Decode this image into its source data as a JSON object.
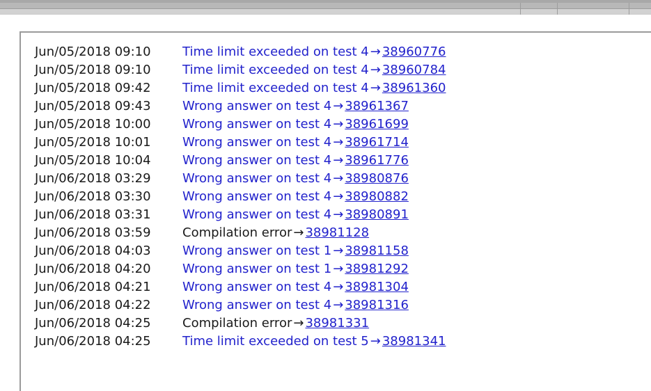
{
  "top_chrome": {
    "divider_positions": [
      747,
      800,
      903
    ]
  },
  "submissions": {
    "rows": [
      {
        "date": "Jun/05/2018 09:10",
        "verdict": "Time limit exceeded on test 4",
        "verdict_style": "blue",
        "arrow": "→",
        "id": "38960776"
      },
      {
        "date": "Jun/05/2018 09:10",
        "verdict": "Time limit exceeded on test 4",
        "verdict_style": "blue",
        "arrow": "→",
        "id": "38960784"
      },
      {
        "date": "Jun/05/2018 09:42",
        "verdict": "Time limit exceeded on test 4",
        "verdict_style": "blue",
        "arrow": "→",
        "id": "38961360"
      },
      {
        "date": "Jun/05/2018 09:43",
        "verdict": "Wrong answer on test 4",
        "verdict_style": "blue",
        "arrow": "→",
        "id": "38961367"
      },
      {
        "date": "Jun/05/2018 10:00",
        "verdict": "Wrong answer on test 4",
        "verdict_style": "blue",
        "arrow": "→",
        "id": "38961699"
      },
      {
        "date": "Jun/05/2018 10:01",
        "verdict": "Wrong answer on test 4",
        "verdict_style": "blue",
        "arrow": "→",
        "id": "38961714"
      },
      {
        "date": "Jun/05/2018 10:04",
        "verdict": "Wrong answer on test 4",
        "verdict_style": "blue",
        "arrow": "→",
        "id": "38961776"
      },
      {
        "date": "Jun/06/2018 03:29",
        "verdict": "Wrong answer on test 4",
        "verdict_style": "blue",
        "arrow": "→",
        "id": "38980876"
      },
      {
        "date": "Jun/06/2018 03:30",
        "verdict": "Wrong answer on test 4",
        "verdict_style": "blue",
        "arrow": "→",
        "id": "38980882"
      },
      {
        "date": "Jun/06/2018 03:31",
        "verdict": "Wrong answer on test 4",
        "verdict_style": "blue",
        "arrow": "→",
        "id": "38980891"
      },
      {
        "date": "Jun/06/2018 03:59",
        "verdict": "Compilation error",
        "verdict_style": "neutral",
        "arrow": "→",
        "id": "38981128"
      },
      {
        "date": "Jun/06/2018 04:03",
        "verdict": "Wrong answer on test 1",
        "verdict_style": "blue",
        "arrow": "→",
        "id": "38981158"
      },
      {
        "date": "Jun/06/2018 04:20",
        "verdict": "Wrong answer on test 1",
        "verdict_style": "blue",
        "arrow": "→",
        "id": "38981292"
      },
      {
        "date": "Jun/06/2018 04:21",
        "verdict": "Wrong answer on test 4",
        "verdict_style": "blue",
        "arrow": "→",
        "id": "38981304"
      },
      {
        "date": "Jun/06/2018 04:22",
        "verdict": "Wrong answer on test 4",
        "verdict_style": "blue",
        "arrow": "→",
        "id": "38981316"
      },
      {
        "date": "Jun/06/2018 04:25",
        "verdict": "Compilation error",
        "verdict_style": "neutral",
        "arrow": "→",
        "id": "38981331"
      },
      {
        "date": "Jun/06/2018 04:25",
        "verdict": "Time limit exceeded on test 5",
        "verdict_style": "blue",
        "arrow": "→",
        "id": "38981341"
      }
    ]
  },
  "colors": {
    "link": "#2222cc",
    "text": "#1a1a1a",
    "chrome_dark": "#a8a8a8",
    "chrome_mid": "#b8b8b8",
    "chrome_light": "#d2d2d2",
    "panel_border": "#9a9a9a"
  }
}
